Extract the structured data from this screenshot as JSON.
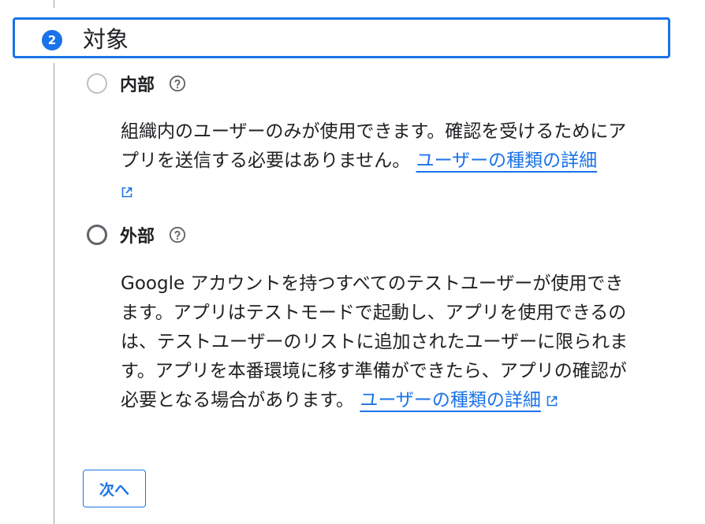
{
  "step": {
    "number": "2",
    "title": "対象"
  },
  "options": {
    "internal": {
      "label": "内部",
      "description": "組織内のユーザーのみが使用できます。確認を受けるためにアプリを送信する必要はありません。",
      "link_text": "ユーザーの種類の詳細",
      "selected": false,
      "disabled": true
    },
    "external": {
      "label": "外部",
      "description": "Google アカウントを持つすべてのテストユーザーが使用できます。アプリはテストモードで起動し、アプリを使用できるのは、テストユーザーのリストに追加されたユーザーに限られます。アプリを本番環境に移す準備ができたら、アプリの確認が必要となる場合があります。",
      "link_text": "ユーザーの種類の詳細",
      "selected": false,
      "disabled": false
    }
  },
  "actions": {
    "next_label": "次へ"
  },
  "icons": {
    "help": "help-circle-icon",
    "external_link": "open-in-new-icon"
  },
  "colors": {
    "accent": "#1a73e8",
    "text": "#202124",
    "muted": "#5f6368"
  }
}
